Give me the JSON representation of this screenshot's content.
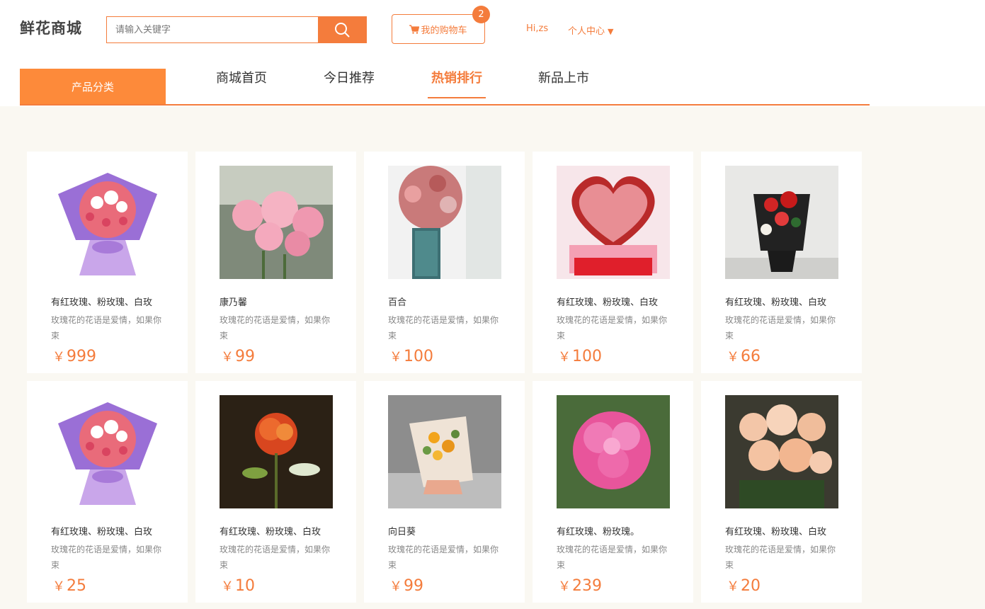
{
  "header": {
    "logo": "鲜花商城",
    "search_placeholder": "请输入关键字",
    "cart_label": "我的购物车",
    "cart_count": "2",
    "greeting": "Hi,zs",
    "user_center": "个人中心"
  },
  "nav": {
    "category": "产品分类",
    "links": [
      "商城首页",
      "今日推荐",
      "热销排行",
      "新品上市"
    ],
    "active": "热销排行"
  },
  "currency": "￥",
  "products": [
    {
      "name": "有红玫瑰、粉玫瑰、白玫",
      "desc": "玫瑰花的花语是爱情，如果你束",
      "price": "999"
    },
    {
      "name": "康乃馨",
      "desc": "玫瑰花的花语是爱情，如果你束",
      "price": "99"
    },
    {
      "name": "百合",
      "desc": "玫瑰花的花语是爱情，如果你束",
      "price": "100"
    },
    {
      "name": "有红玫瑰、粉玫瑰、白玫",
      "desc": "玫瑰花的花语是爱情，如果你束",
      "price": "100"
    },
    {
      "name": "有红玫瑰、粉玫瑰、白玫",
      "desc": "玫瑰花的花语是爱情，如果你束",
      "price": "66"
    },
    {
      "name": "有红玫瑰、粉玫瑰、白玫",
      "desc": "玫瑰花的花语是爱情，如果你束",
      "price": "25"
    },
    {
      "name": "有红玫瑰、粉玫瑰、白玫",
      "desc": "玫瑰花的花语是爱情，如果你束",
      "price": "10"
    },
    {
      "name": "向日葵",
      "desc": "玫瑰花的花语是爱情，如果你束",
      "price": "99"
    },
    {
      "name": "有红玫瑰、粉玫瑰。",
      "desc": "玫瑰花的花语是爱情，如果你束",
      "price": "239"
    },
    {
      "name": "有红玫瑰、粉玫瑰、白玫",
      "desc": "玫瑰花的花语是爱情，如果你束",
      "price": "20"
    }
  ],
  "colors": {
    "accent": "#f47c3c",
    "nav_category_bg": "#fd8a3a",
    "content_bg": "#faf8f2"
  }
}
